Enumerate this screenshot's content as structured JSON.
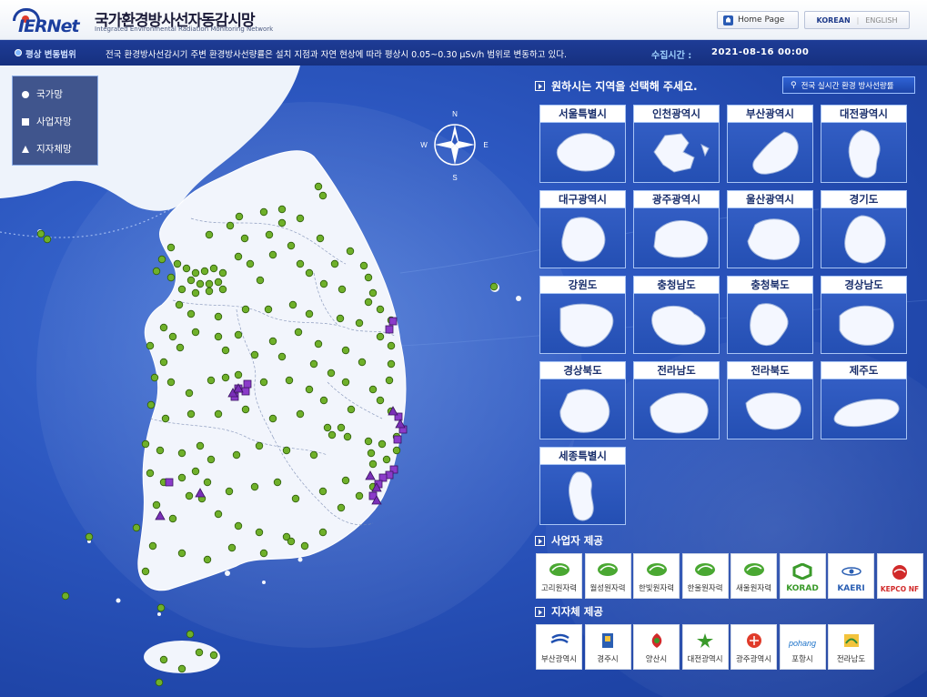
{
  "header": {
    "logo_text": "IERNet",
    "site_title": "국가환경방사선자동감시망",
    "site_subtitle": "Integrated Environmental Radiation Monitoring Network",
    "home_button": "Home Page",
    "lang_korean": "KOREAN",
    "lang_english": "ENGLISH"
  },
  "infobar": {
    "label": "평상 변동범위",
    "text": "전국 환경방사선감시기 주변 환경방사선량률은 설치 지점과 자연 현상에 따라 평상시 0.05~0.30 μSv/h 범위로 변동하고 있다.",
    "time_label": "수집시간 :",
    "time_value": "2021-08-16 00:00"
  },
  "legend": {
    "items": [
      {
        "label": "국가망",
        "shape": "circle"
      },
      {
        "label": "사업자망",
        "shape": "square"
      },
      {
        "label": "지자체망",
        "shape": "triangle"
      }
    ]
  },
  "compass": {
    "n": "N",
    "s": "S",
    "e": "E",
    "w": "W"
  },
  "region_panel": {
    "prompt": "원하시는 지역을 선택해 주세요.",
    "nationwide_button": "전국 실시간 환경 방사선량률",
    "regions": [
      {
        "label": "서울특별시"
      },
      {
        "label": "인천광역시"
      },
      {
        "label": "부산광역시"
      },
      {
        "label": "대전광역시"
      },
      {
        "label": "대구광역시"
      },
      {
        "label": "광주광역시"
      },
      {
        "label": "울산광역시"
      },
      {
        "label": "경기도"
      },
      {
        "label": "강원도"
      },
      {
        "label": "충청남도"
      },
      {
        "label": "충청북도"
      },
      {
        "label": "경상남도"
      },
      {
        "label": "경상북도"
      },
      {
        "label": "전라남도"
      },
      {
        "label": "전라북도"
      },
      {
        "label": "제주도"
      },
      {
        "label": "세종특별시"
      }
    ]
  },
  "operators": {
    "title": "사업자 제공",
    "items": [
      {
        "label": "고리원자력",
        "icon": "khnp-leaf-icon"
      },
      {
        "label": "월성원자력",
        "icon": "khnp-leaf-icon"
      },
      {
        "label": "한빛원자력",
        "icon": "khnp-leaf-icon"
      },
      {
        "label": "한울원자력",
        "icon": "khnp-leaf-icon"
      },
      {
        "label": "새울원자력",
        "icon": "khnp-leaf-icon"
      },
      {
        "label": "KORAD",
        "icon": "korad-hexagon-icon"
      },
      {
        "label": "KAERI",
        "icon": "kaeri-atom-icon"
      },
      {
        "label": "KEPCO NF",
        "icon": "kepco-swirl-icon"
      }
    ]
  },
  "local_gov": {
    "title": "지자체 제공",
    "items": [
      {
        "label": "부산광역시",
        "icon": "busan-emblem-icon"
      },
      {
        "label": "경주시",
        "icon": "gyeongju-emblem-icon"
      },
      {
        "label": "양산시",
        "icon": "yangsan-emblem-icon"
      },
      {
        "label": "대전광역시",
        "icon": "daejeon-emblem-icon"
      },
      {
        "label": "광주광역시",
        "icon": "gwangju-emblem-icon"
      },
      {
        "label": "포항시",
        "icon": "pohang-emblem-icon",
        "wordmark": "pohang"
      },
      {
        "label": "전라남도",
        "icon": "jeonnam-emblem-icon"
      }
    ]
  },
  "colors": {
    "header_bar": "#1e3c96",
    "map_sea": "#2c57c0",
    "national_marker": "#6fb02a",
    "operator_marker": "#8b3bc9",
    "local_marker": "#7a2fb8"
  }
}
